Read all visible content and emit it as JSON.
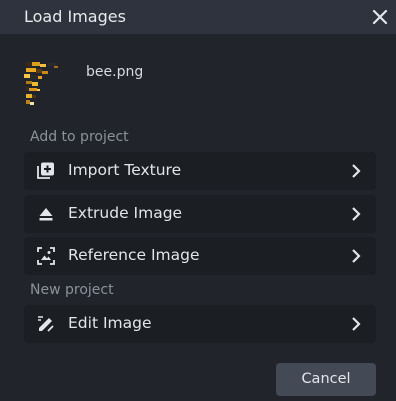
{
  "dialog": {
    "title": "Load Images",
    "close_icon": "close-icon"
  },
  "file": {
    "name": "bee.png",
    "thumbnail_icon": "pixel-art-bee-thumbnail"
  },
  "sections": {
    "add_to_project": "Add to project",
    "new_project": "New project"
  },
  "options": [
    {
      "label": "Import Texture",
      "icon": "import-texture-icon"
    },
    {
      "label": "Extrude Image",
      "icon": "extrude-icon"
    },
    {
      "label": "Reference Image",
      "icon": "reference-image-icon"
    },
    {
      "label": "Edit Image",
      "icon": "edit-image-icon"
    }
  ],
  "buttons": {
    "cancel": "Cancel"
  },
  "colors": {
    "background": "#21252b",
    "titlebar": "#2f333d",
    "option_background": "#1b1e23",
    "button_background": "#434955",
    "section_label": "#8b919b"
  }
}
